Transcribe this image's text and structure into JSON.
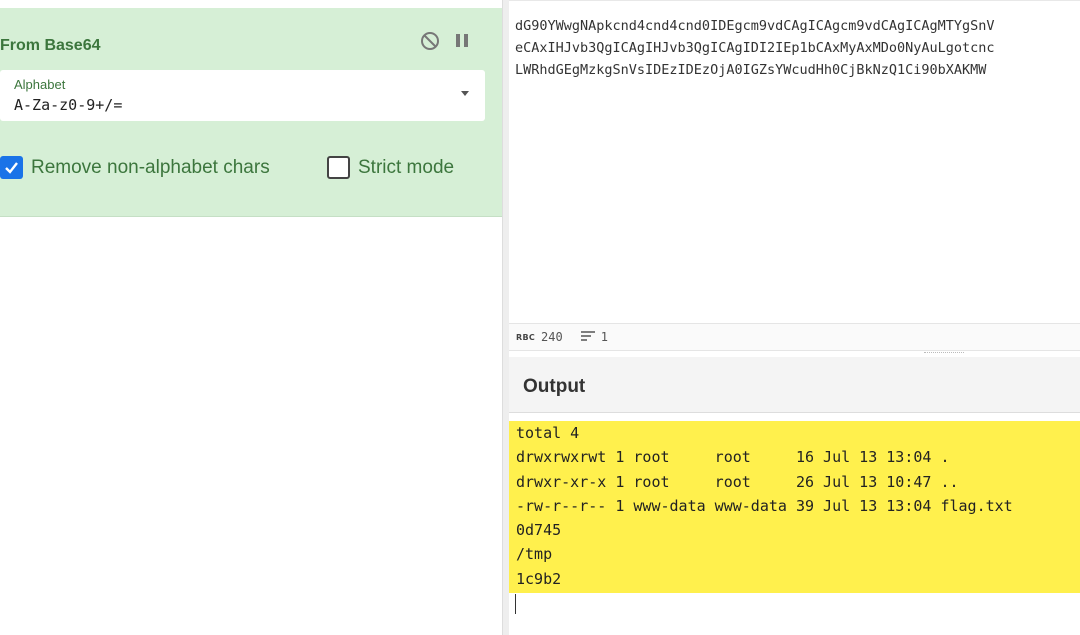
{
  "recipe": {
    "operation": {
      "title": "From Base64",
      "controls": [
        "disable-icon",
        "pause-icon"
      ],
      "alphabet": {
        "label": "Alphabet",
        "value": "A-Za-z0-9+/="
      },
      "remove_non_alphabet": {
        "label": "Remove non-alphabet chars",
        "checked": true
      },
      "strict_mode": {
        "label": "Strict mode",
        "checked": false
      }
    }
  },
  "input": {
    "lines": [
      "dG90YWwgNApkcnd4cnd4cnd0IDEgcm9vdCAgICAgcm9vdCAgICAgMTYgSnV",
      "eCAxIHJvb3QgICAgIHJvb3QgICAgIDI2IEp1bCAxMyAxMDo0NyAuLgotcnc",
      "LWRhdGEgMzkgSnVsIDEzIDEzOjA0IGZsYWcudHh0CjBkNzQ1Ci90bXAKMW"
    ],
    "char_count": "240",
    "line_count": "1"
  },
  "output": {
    "title": "Output",
    "lines": [
      "total 4",
      "drwxrwxrwt 1 root     root     16 Jul 13 13:04 .",
      "drwxr-xr-x 1 root     root     26 Jul 13 10:47 ..",
      "-rw-r--r-- 1 www-data www-data 39 Jul 13 13:04 flag.txt",
      "0d745",
      "/tmp",
      "1c9b2"
    ]
  },
  "colors": {
    "operation_bg": "#d6efd6",
    "operation_text": "#3c763d",
    "checkbox_checked": "#1a73e8",
    "output_highlight": "#fff04d"
  }
}
